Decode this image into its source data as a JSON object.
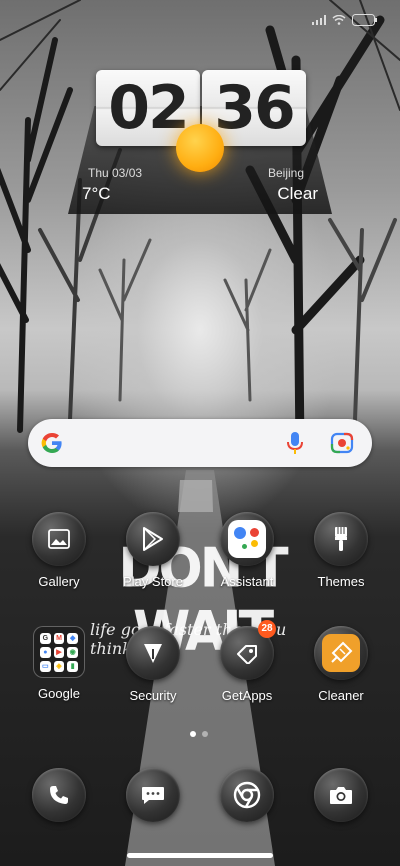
{
  "clock": {
    "hours": "02",
    "minutes": "36"
  },
  "weather": {
    "date": "Thu  03/03",
    "city": "Beijing",
    "temperature": "7°C",
    "condition": "Clear"
  },
  "wallpaper_text": {
    "headline": "DON'T WAIT",
    "tagline": "life goes faster than you think"
  },
  "apps_row1": [
    {
      "label": "Gallery",
      "icon": "gallery-icon"
    },
    {
      "label": "Play Store",
      "icon": "play-store-icon"
    },
    {
      "label": "Assistant",
      "icon": "assistant-icon"
    },
    {
      "label": "Themes",
      "icon": "themes-icon"
    }
  ],
  "apps_row2": [
    {
      "label": "Google",
      "icon": "google-folder-icon"
    },
    {
      "label": "Security",
      "icon": "security-icon"
    },
    {
      "label": "GetApps",
      "icon": "getapps-icon",
      "badge": "28"
    },
    {
      "label": "Cleaner",
      "icon": "cleaner-icon"
    }
  ],
  "dock": [
    {
      "icon": "phone-icon"
    },
    {
      "icon": "messages-icon"
    },
    {
      "icon": "chrome-icon"
    },
    {
      "icon": "camera-icon"
    }
  ],
  "colors": {
    "badge": "#ff5a1f",
    "sun": "#ffae12",
    "cleaner": "#f0a02a"
  },
  "page_indicator": {
    "pages": 2,
    "current": 1
  }
}
